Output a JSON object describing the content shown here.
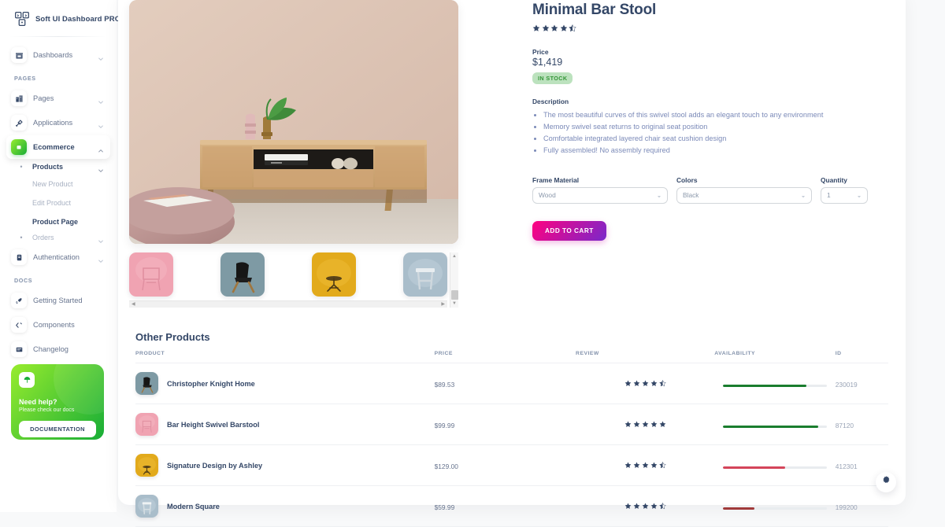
{
  "brand": {
    "name": "Soft UI Dashboard PRO",
    "logo_icon": "soft-ui-logo-icon"
  },
  "sidebar": {
    "top_items": [
      {
        "label": "Dashboards",
        "icon": "shop-icon",
        "chevron": "chevron-down-icon"
      }
    ],
    "section_pages_label": "PAGES",
    "page_items": [
      {
        "label": "Pages",
        "icon": "office-icon",
        "chevron": "chevron-down-icon"
      },
      {
        "label": "Applications",
        "icon": "settings-icon",
        "chevron": "chevron-down-icon"
      },
      {
        "label": "Ecommerce",
        "icon": "basket-icon",
        "chevron": "chevron-up-icon",
        "active": true
      }
    ],
    "ecommerce_children": [
      {
        "label": "Products",
        "type": "group",
        "bullet": "•",
        "chevron": "chevron-down-icon",
        "bold": true
      },
      {
        "label": "New Product",
        "type": "leaf",
        "muted": true
      },
      {
        "label": "Edit Product",
        "type": "leaf",
        "muted": true
      },
      {
        "label": "Product Page",
        "type": "leaf",
        "current": true
      },
      {
        "label": "Orders",
        "type": "group",
        "bullet": "•",
        "chevron": "chevron-down-icon",
        "muted": true
      }
    ],
    "after_items": [
      {
        "label": "Authentication",
        "icon": "key-icon",
        "chevron": "chevron-down-icon"
      }
    ],
    "section_docs_label": "DOCS",
    "doc_items": [
      {
        "label": "Getting Started",
        "icon": "rocket-icon",
        "chevron": ""
      },
      {
        "label": "Components",
        "icon": "code-icon",
        "chevron": ""
      },
      {
        "label": "Changelog",
        "icon": "list-icon",
        "chevron": ""
      }
    ],
    "help_card": {
      "icon": "umbrella-icon",
      "title": "Need help?",
      "subtitle": "Please check our docs",
      "button_label": "DOCUMENTATION",
      "color": "#17ad37"
    }
  },
  "product": {
    "title": "Minimal Bar Stool",
    "rating": 4.5,
    "price_label": "Price",
    "price_value": "$1,419",
    "stock_badge": "IN STOCK",
    "stock_badge_color": "#bce2be",
    "description_label": "Description",
    "description_items": [
      "The most beautiful curves of this swivel stool adds an elegant touch to any environment",
      "Memory swivel seat returns to original seat position",
      "Comfortable integrated layered chair seat cushion design",
      "Fully assembled! No assembly required"
    ],
    "selectors": [
      {
        "label": "Frame Material",
        "value": "Wood",
        "name": "frame-material-select"
      },
      {
        "label": "Colors",
        "value": "Black",
        "name": "colors-select"
      },
      {
        "label": "Quantity",
        "value": "1",
        "name": "quantity-select"
      }
    ],
    "cart_button": "ADD TO CART",
    "cart_button_color": "#cb0c9f",
    "gallery": {
      "hero_alt": "living-room-wooden-console-with-plant",
      "thumbnails": [
        {
          "name": "thumb-pink-chair",
          "bg": "#f0a0b0"
        },
        {
          "name": "thumb-teal-black-chair",
          "bg": "#7d9aa3"
        },
        {
          "name": "thumb-yellow-stool",
          "bg": "#e0a820"
        },
        {
          "name": "thumb-blue-stool",
          "bg": "#a8bcc9"
        }
      ],
      "scroll_left_icon": "chevron-left-icon",
      "scroll_right_icon": "chevron-right-icon",
      "scroll_up_icon": "chevron-up-icon",
      "scroll_down_icon": "chevron-down-icon"
    }
  },
  "other_products": {
    "title": "Other Products",
    "columns": [
      "PRODUCT",
      "PRICE",
      "REVIEW",
      "AVAILABILITY",
      "ID"
    ],
    "rows": [
      {
        "name": "Christopher Knight Home",
        "price": "$89.53",
        "review": 4.5,
        "availability_percent": 80,
        "availability_color": "#1a7d2e",
        "id": "230019",
        "thumb": "thumb-teal-black-chair"
      },
      {
        "name": "Bar Height Swivel Barstool",
        "price": "$99.99",
        "review": 5,
        "availability_percent": 92,
        "availability_color": "#1a7d2e",
        "id": "87120",
        "thumb": "thumb-pink-chair"
      },
      {
        "name": "Signature Design by Ashley",
        "price": "$129.00",
        "review": 4.5,
        "availability_percent": 60,
        "availability_color": "#d4455a",
        "id": "412301",
        "thumb": "thumb-yellow-stool"
      },
      {
        "name": "Modern Square",
        "price": "$59.99",
        "review": 4.5,
        "availability_percent": 30,
        "availability_color": "#a03a3a",
        "id": "199200",
        "thumb": "thumb-blue-stool"
      }
    ]
  },
  "fab": {
    "icon": "gear-icon"
  }
}
